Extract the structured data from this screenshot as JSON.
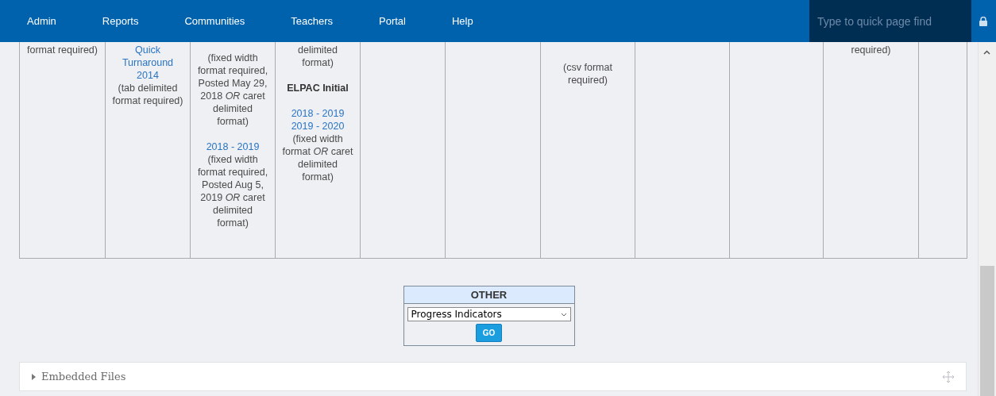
{
  "nav": {
    "items": [
      {
        "label": "Admin"
      },
      {
        "label": "Reports"
      },
      {
        "label": "Communities"
      },
      {
        "label": "Teachers"
      },
      {
        "label": "Portal"
      },
      {
        "label": "Help"
      }
    ],
    "search": {
      "placeholder": "Type to quick page find"
    }
  },
  "table": {
    "cells": [
      [
        [
          {
            "kind": "note",
            "text": "format required)"
          }
        ]
      ],
      [
        [
          {
            "kind": "link",
            "text": "Quick Turnaround 2014"
          },
          {
            "kind": "note",
            "text": "(tab delimited format required)"
          }
        ]
      ],
      [
        [
          {
            "kind": "note",
            "text": "(fixed width format required, Posted May 29, 2018 *OR* caret delimited format)"
          }
        ],
        [
          {
            "kind": "link",
            "text": "2018 - 2019"
          },
          {
            "kind": "note",
            "text": "(fixed width format required, Posted Aug 5, 2019 *OR* caret delimited format)"
          }
        ]
      ],
      [
        [
          {
            "kind": "note",
            "text": "delimited format)"
          }
        ],
        [
          {
            "kind": "heading",
            "text": "ELPAC Initial"
          }
        ],
        [
          {
            "kind": "link",
            "text": "2018 - 2019"
          },
          {
            "kind": "link",
            "text": "2019 - 2020"
          },
          {
            "kind": "note",
            "text": "(fixed width format *OR* caret delimited format)"
          }
        ]
      ],
      [],
      [],
      [
        [
          {
            "kind": "note",
            "text": "(csv format required)"
          }
        ]
      ],
      [],
      [],
      [
        [
          {
            "kind": "note",
            "text": "required)"
          }
        ]
      ],
      []
    ]
  },
  "other": {
    "title": "OTHER",
    "select": {
      "value": "Progress Indicators"
    },
    "button": "GO"
  },
  "panel": {
    "title": "Embedded Files",
    "expanded": false
  }
}
